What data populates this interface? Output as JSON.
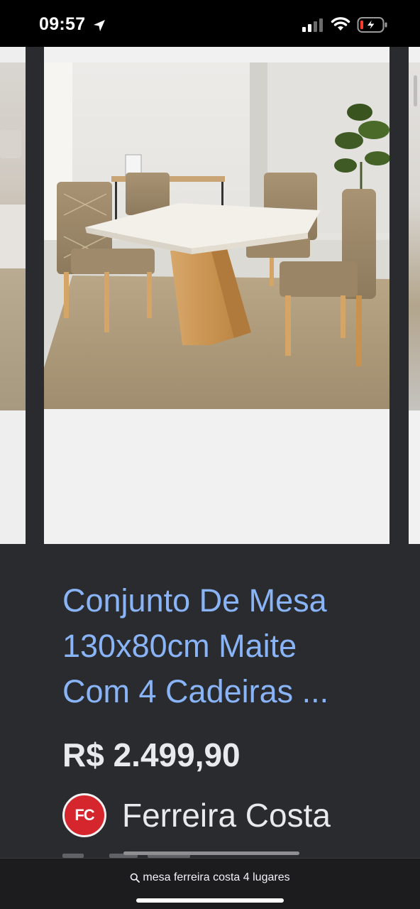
{
  "status_bar": {
    "time": "09:57",
    "icons": [
      "location-arrow-icon",
      "cellular-signal-icon",
      "wifi-icon",
      "battery-charging-icon"
    ]
  },
  "product": {
    "image_alt": "Conjunto de mesa com 4 cadeiras",
    "title_lines": [
      "Conjunto De Mesa",
      "130x80cm Maite",
      "Com 4 Cadeiras ..."
    ],
    "price": "R$ 2.499,90",
    "store": {
      "logo_text": "FC",
      "name": "Ferreira Costa"
    }
  },
  "search_bar": {
    "query": "mesa ferreira costa 4 lugares"
  },
  "colors": {
    "title_link": "#8ab4f8",
    "text": "#e8eaed",
    "card_background": "#2a2b2e",
    "store_logo": "#d6262d"
  }
}
